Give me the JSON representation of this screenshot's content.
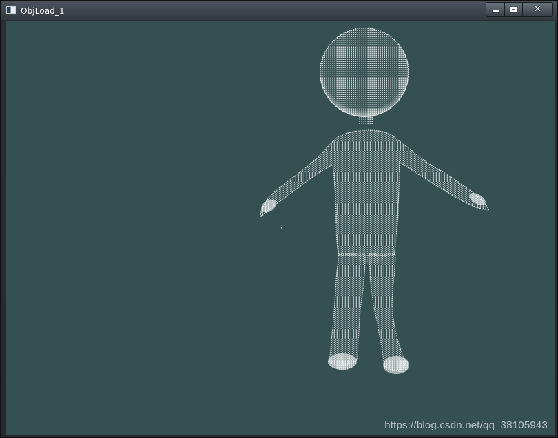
{
  "window": {
    "title": "ObjLoad_1",
    "controls": {
      "minimize_icon": "minimize-icon",
      "maximize_icon": "maximize-icon",
      "close_glyph": "✕"
    }
  },
  "viewport": {
    "background_color": "#355050",
    "point_color": "#ffffff",
    "render_mode": "point-cloud",
    "model": "humanoid figure"
  },
  "watermark": "https://blog.csdn.net/qq_38105943"
}
